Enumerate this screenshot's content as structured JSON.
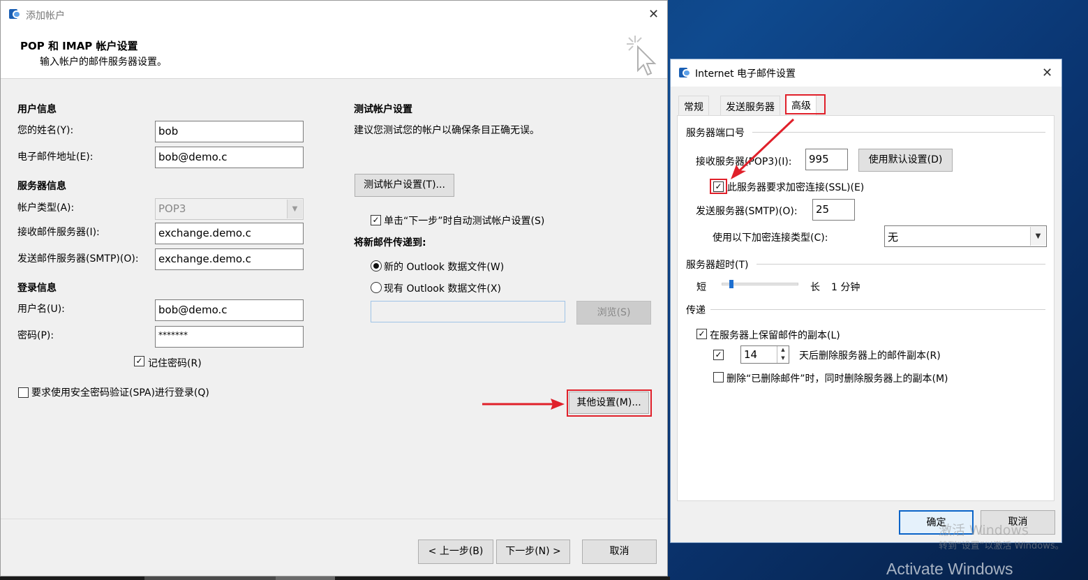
{
  "main_dialog": {
    "title": "添加帐户",
    "header_title": "POP 和 IMAP 帐户设置",
    "header_subtitle": "输入帐户的邮件服务器设置。",
    "user_info": {
      "section": "用户信息",
      "name_label": "您的姓名(Y):",
      "name_value": "bob",
      "email_label": "电子邮件地址(E):",
      "email_value": "bob@demo.c"
    },
    "server_info": {
      "section": "服务器信息",
      "account_type_label": "帐户类型(A):",
      "account_type_value": "POP3",
      "incoming_label": "接收邮件服务器(I):",
      "incoming_value": "exchange.demo.c",
      "outgoing_label": "发送邮件服务器(SMTP)(O):",
      "outgoing_value": "exchange.demo.c"
    },
    "login_info": {
      "section": "登录信息",
      "username_label": "用户名(U):",
      "username_value": "bob@demo.c",
      "password_label": "密码(P):",
      "password_value": "*******",
      "remember_label": "记住密码(R)",
      "remember_checked": true,
      "spa_label": "要求使用安全密码验证(SPA)进行登录(Q)",
      "spa_checked": false
    },
    "test_settings": {
      "section": "测试帐户设置",
      "description": "建议您测试您的帐户以确保条目正确无误。",
      "test_button": "测试帐户设置(T)...",
      "auto_test_label": "单击“下一步”时自动测试帐户设置(S)",
      "auto_test_checked": true
    },
    "deliver": {
      "section": "将新邮件传递到:",
      "new_file_label": "新的 Outlook 数据文件(W)",
      "existing_file_label": "现有 Outlook 数据文件(X)",
      "selected": "new",
      "path_value": "",
      "browse_button": "浏览(S)"
    },
    "more_settings_button": "其他设置(M)...",
    "back_button": "< 上一步(B)",
    "next_button": "下一步(N) >",
    "cancel_button": "取消"
  },
  "internet_dialog": {
    "title": "Internet 电子邮件设置",
    "tabs": [
      "常规",
      "发送服务器",
      "高级"
    ],
    "active_tab": "高级",
    "ports_section": "服务器端口号",
    "incoming_label": "接收服务器(POP3)(I):",
    "incoming_port": "995",
    "use_defaults_button": "使用默认设置(D)",
    "ssl_label": "此服务器要求加密连接(SSL)(E)",
    "ssl_checked": true,
    "outgoing_label": "发送服务器(SMTP)(O):",
    "outgoing_port": "25",
    "encryption_label": "使用以下加密连接类型(C):",
    "encryption_value": "无",
    "timeout_section": "服务器超时(T)",
    "timeout_short": "短",
    "timeout_long": "长",
    "timeout_value": "1 分钟",
    "timeout_level": 0.1,
    "delivery_section": "传递",
    "leave_copy_label": "在服务器上保留邮件的副本(L)",
    "leave_copy_checked": true,
    "remove_after_checked": true,
    "remove_after_days": "14",
    "remove_after_label": "天后删除服务器上的邮件副本(R)",
    "remove_deleted_label": "删除“已删除邮件”时，同时删除服务器上的副本(M)",
    "remove_deleted_checked": false,
    "ok_button": "确定",
    "cancel_button": "取消"
  },
  "watermark": {
    "line1": "激活 Windows",
    "line2": "转到“设置”以激活 Windows。",
    "line3": "Activate Windows"
  },
  "colors": {
    "annotation_red": "#e0202a",
    "desktop_blue": "#0f4a8f"
  }
}
